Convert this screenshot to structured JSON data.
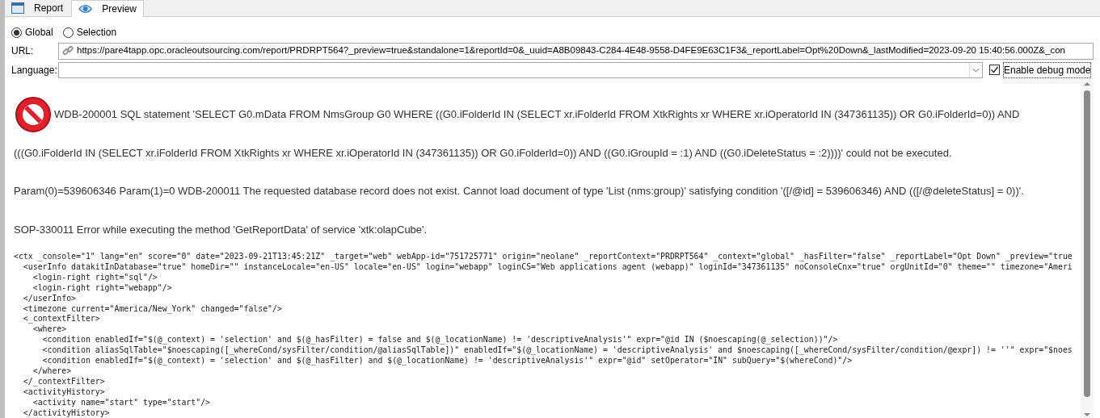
{
  "tabs": [
    {
      "label": "Report",
      "selected": false
    },
    {
      "label": "Preview",
      "selected": true
    }
  ],
  "scope": [
    {
      "label": "Global",
      "selected": true
    },
    {
      "label": "Selection",
      "selected": false
    }
  ],
  "url": {
    "label": "URL:",
    "value": "https://pare4tapp.opc.oracleoutsourcing.com/report/PRDRPT564?_preview=true&standalone=1&reportId=0&_uuid=A8B09843-C284-4E48-9558-D4FE9E63C1F3&_reportLabel=Opt%20Down&_lastModified=2023-09-20 15:40:56.000Z&_con"
  },
  "language": {
    "label": "Language:"
  },
  "debug": {
    "label": "Enable debug mode",
    "checked": true
  },
  "errors": [
    "WDB-200001 SQL statement 'SELECT G0.mData FROM NmsGroup G0 WHERE ((G0.iFolderId IN (SELECT xr.iFolderId FROM XtkRights xr WHERE xr.iOperatorId IN (347361135)) OR G0.iFolderId=0)) AND",
    "(((G0.iFolderId IN (SELECT xr.iFolderId FROM XtkRights xr WHERE xr.iOperatorId IN (347361135)) OR G0.iFolderId=0)) AND ((G0.iGroupId = :1) AND ((G0.iDeleteStatus = :2))))' could not be executed.",
    "Param(0)=539606346 Param(1)=0 WDB-200011 The requested database record does not exist. Cannot load document of type 'List (nms:group)' satisfying condition '([/@id] = 539606346) AND (([/@deleteStatus] = 0))'.",
    "SOP-330011 Error while executing the method 'GetReportData' of service 'xtk:olapCube'."
  ],
  "code_lines": [
    "<ctx _console=\"1\" lang=\"en\" score=\"0\" date=\"2023-09-21T13:45:21Z\" _target=\"web\" webApp-id=\"751725771\" origin=\"neolane\" _reportContext=\"PRDRPT564\" _context=\"global\" _hasFilter=\"false\" _reportLabel=\"Opt Down\" _preview=\"true",
    "  <userInfo datakitInDatabase=\"true\" homeDir=\"\" instanceLocale=\"en-US\" locale=\"en-US\" login=\"webapp\" loginCS=\"Web applications agent (webapp)\" loginId=\"347361135\" noConsoleCnx=\"true\" orgUnitId=\"0\" theme=\"\" timezone=\"Ameri",
    "    <login-right right=\"sql\"/>",
    "    <login-right right=\"webapp\"/>",
    "  </userInfo>",
    "  <timezone current=\"America/New_York\" changed=\"false\"/>",
    "  <_contextFilter>",
    "    <where>",
    "      <condition enabledIf=\"$(@_context) = 'selection' and $(@_hasFilter) = false and $(@_locationName) != 'descriptiveAnalysis'\" expr=\"@id IN ($noescaping(@_selection))\"/>",
    "      <condition aliasSqlTable=\"$noescaping([_whereCond/sysFilter/condition/@aliasSqlTable])\" enabledIf=\"$(@_locationName) = 'descriptiveAnalysis' and $noescaping([_whereCond/sysFilter/condition/@expr]) != ''\" expr=\"$noes",
    "      <condition enabledIf=\"$(@_context) = 'selection' and $(@_hasFilter) and $(@_locationName) != 'descriptiveAnalysis'\" expr=\"@id\" setOperator=\"IN\" subQuery=\"$(whereCond)\"/>",
    "    </where>",
    "  </_contextFilter>",
    "  <activityHistory>",
    "    <activity name=\"start\" type=\"start\"/>",
    "  </activityHistory>"
  ]
}
